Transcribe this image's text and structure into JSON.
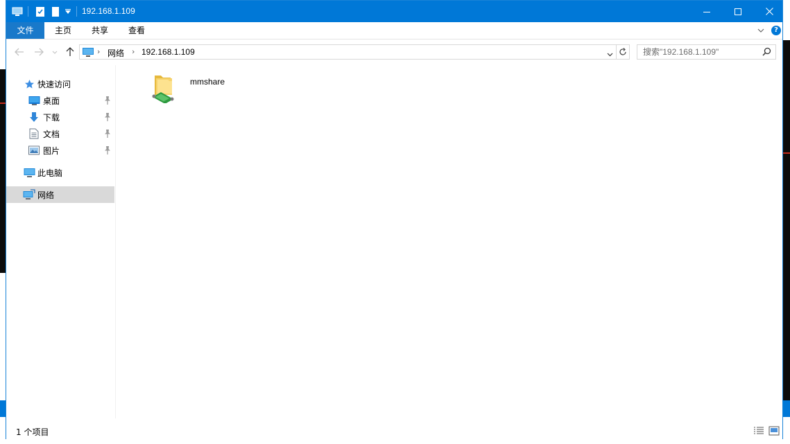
{
  "window": {
    "title": "192.168.1.109",
    "accent": "#0078d7",
    "caption": {
      "minimize": "–",
      "maximize": "☐",
      "close": "✕"
    }
  },
  "ribbon": {
    "tabs": [
      {
        "label": "文件"
      },
      {
        "label": "主页"
      },
      {
        "label": "共享"
      },
      {
        "label": "查看"
      }
    ],
    "help_icon": "help-icon"
  },
  "address": {
    "crumbs": [
      "网络",
      "192.168.1.109"
    ],
    "search_placeholder": "搜索\"192.168.1.109\""
  },
  "nav": {
    "quick_access": "快速访问",
    "items": [
      {
        "label": "桌面",
        "icon": "desktop-icon",
        "pinned": true
      },
      {
        "label": "下载",
        "icon": "download-icon",
        "pinned": true
      },
      {
        "label": "文档",
        "icon": "document-icon",
        "pinned": true
      },
      {
        "label": "图片",
        "icon": "pictures-icon",
        "pinned": true
      }
    ],
    "this_pc": "此电脑",
    "network": "网络"
  },
  "content": {
    "items": [
      {
        "name": "mmshare",
        "type": "network-share"
      }
    ]
  },
  "status": {
    "item_count": "1 个项目"
  }
}
